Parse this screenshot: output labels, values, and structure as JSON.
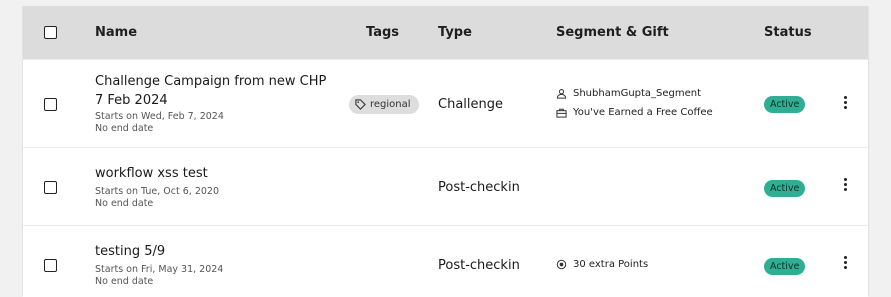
{
  "header": {
    "name": "Name",
    "tags": "Tags",
    "type": "Type",
    "segment_gift": "Segment & Gift",
    "status": "Status"
  },
  "rows": [
    {
      "title": "Challenge Campaign from new CHP 7 Feb 2024",
      "starts": "Starts on Wed, Feb 7, 2024",
      "end": "No end date",
      "tag": "regional",
      "type": "Challenge",
      "segment": "ShubhamGupta_Segment",
      "gift": "You've Earned a Free Coffee",
      "status": "Active"
    },
    {
      "title": "workflow xss test",
      "starts": "Starts on Tue, Oct 6, 2020",
      "end": "No end date",
      "type": "Post-checkin",
      "status": "Active"
    },
    {
      "title": "testing 5/9",
      "starts": "Starts on Fri, May 31, 2024",
      "end": "No end date",
      "type": "Post-checkin",
      "points": "30 extra Points",
      "status": "Active"
    }
  ],
  "colors": {
    "header_bg": "#dcdcdc",
    "status_bg": "#2fae93",
    "tag_bg": "#dddddd"
  },
  "icons": [
    "checkbox-icon",
    "tag-icon",
    "user-icon",
    "gift-icon",
    "points-icon",
    "kebab-menu-icon"
  ]
}
